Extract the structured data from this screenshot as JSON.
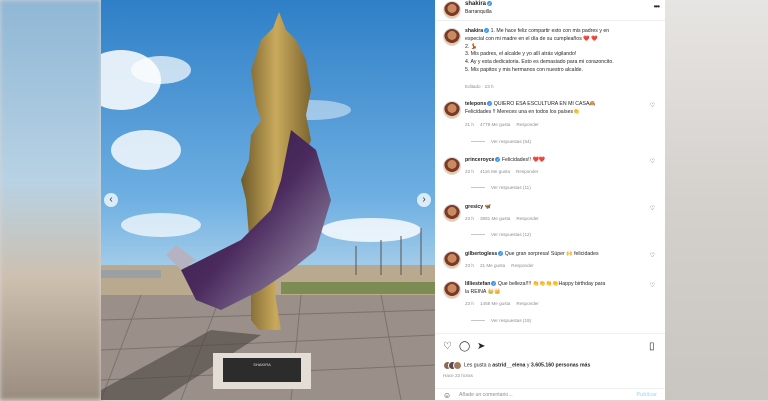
{
  "header": {
    "username": "shakira",
    "location": "Barranquilla"
  },
  "caption": {
    "username": "shakira",
    "lines": [
      "1. Me hace feliz compartir esto con mis padres y en",
      "especial con mi madre en el día de su cumpleaños ❤️ ❤️",
      "2. 💃",
      "3. Mis padres, el alcalde y yo allí atrás vigilando!",
      "4. Ay y esta dedicatoria. Esto es demasiado para mi corazoncito.",
      "5. Mis papitos y mis hermanos con nuestro alcalde."
    ],
    "time": "Editado · 23 h"
  },
  "comments": [
    {
      "user": "telepons",
      "text": "QUIERO ESA ESCULTURA EN MI CASA🙈",
      "text2": "Felicidades !! Mereces una en todos los países👏",
      "time": "21 h",
      "likes": "4778 Me gusta",
      "reply": "Responder",
      "view_replies": "Ver respuestas (54)"
    },
    {
      "user": "princeroyce",
      "text": "Felicidades!! ❤️❤️",
      "text2": "",
      "time": "23 h",
      "likes": "4116 Me gusta",
      "reply": "Responder",
      "view_replies": "Ver respuestas (11)"
    },
    {
      "user": "gresicy",
      "text": "🦋",
      "text2": "",
      "time": "23 h",
      "likes": "3881 Me gusta",
      "reply": "Responder",
      "view_replies": "Ver respuestas (12)"
    },
    {
      "user": "gilbertogless",
      "text": "Que gran sorpresa! Súper 🙌 felicidades",
      "text2": "",
      "time": "23 h",
      "likes": "21 Me gusta",
      "reply": "Responder",
      "view_replies": ""
    },
    {
      "user": "lilliestefan",
      "text": "Que belleza!!!! 👏👏👏👏Happy birthday para",
      "text2": "la REINA 👑👑",
      "time": "23 h",
      "likes": "1458 Me gusta",
      "reply": "Responder",
      "view_replies": "Ver respuestas (19)"
    }
  ],
  "likes": {
    "text_pre": "Les gusta a ",
    "users": "astrid__elena",
    "text_mid": " y ",
    "count": "3.605.160 personas más"
  },
  "post_time": "Hace 23 horas",
  "add_comment": {
    "placeholder": "Añade un comentario...",
    "post": "Publicar"
  },
  "plaque_text": "SHAKIRA"
}
